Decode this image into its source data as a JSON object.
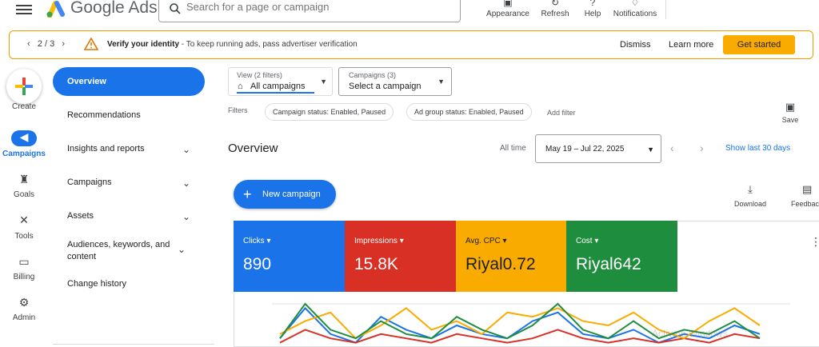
{
  "app": {
    "brand": "Google Ads"
  },
  "search": {
    "placeholder": "Search for a page or campaign"
  },
  "toolbar": {
    "items": [
      {
        "label": "Appearance",
        "icon": "appearance-icon"
      },
      {
        "label": "Refresh",
        "icon": "refresh-icon"
      },
      {
        "label": "Help",
        "icon": "help-icon"
      },
      {
        "label": "Notifications",
        "icon": "bell-icon"
      }
    ]
  },
  "banner": {
    "pager": "2 / 3",
    "title": "Verify your identity",
    "message": " - To keep running ads, pass advertiser verification",
    "dismiss": "Dismiss",
    "learn_more": "Learn more",
    "cta": "Get started",
    "accent": "#f9ab00"
  },
  "rail": {
    "create": "Create",
    "items": [
      {
        "label": "Campaigns",
        "icon": "megaphone-icon",
        "active": true
      },
      {
        "label": "Goals",
        "icon": "trophy-icon"
      },
      {
        "label": "Tools",
        "icon": "tools-icon"
      },
      {
        "label": "Billing",
        "icon": "billing-icon"
      },
      {
        "label": "Admin",
        "icon": "gear-icon"
      }
    ]
  },
  "sidenav": {
    "items": [
      {
        "label": "Overview",
        "active": true
      },
      {
        "label": "Recommendations"
      },
      {
        "label": "Insights and reports",
        "expandable": true
      },
      {
        "label": "Campaigns",
        "expandable": true
      },
      {
        "label": "Assets",
        "expandable": true
      },
      {
        "label": "Audiences, keywords, and content",
        "expandable": true
      },
      {
        "label": "Change history"
      }
    ]
  },
  "view_selector": {
    "caption": "View (2 filters)",
    "value": "All campaigns"
  },
  "campaign_selector": {
    "caption": "Campaigns (3)",
    "value": "Select a campaign"
  },
  "filters": {
    "label": "Filters",
    "chips": [
      "Campaign status: Enabled, Paused",
      "Ad group status: Enabled, Paused"
    ],
    "add": "Add filter",
    "save": "Save"
  },
  "overview": {
    "title": "Overview",
    "range_label": "All time",
    "date_range": "May 19 – Jul 22, 2025",
    "show_last": "Show last 30 days",
    "new_campaign": "New campaign",
    "download": "Download",
    "feedback": "Feedback"
  },
  "metrics": [
    {
      "name": "Clicks",
      "value": "890",
      "color": "#1a73e8"
    },
    {
      "name": "Impressions",
      "value": "15.8K",
      "color": "#d93025"
    },
    {
      "name": "Avg. CPC",
      "value": "Riyal0.72",
      "color": "#f9ab00"
    },
    {
      "name": "Cost",
      "value": "Riyal642",
      "color": "#1e8e3e"
    }
  ],
  "chart_data": {
    "type": "line",
    "series": [
      {
        "color": "#1a73e8",
        "values": [
          2,
          9,
          3,
          1,
          7,
          4,
          2,
          5,
          3,
          2,
          6,
          8,
          3,
          2,
          4,
          1,
          3,
          2,
          5,
          3
        ]
      },
      {
        "color": "#d93025",
        "values": [
          1,
          4,
          2,
          1,
          3,
          2,
          1,
          3,
          2,
          1,
          2,
          4,
          2,
          1,
          2,
          1,
          2,
          1,
          3,
          2
        ]
      },
      {
        "color": "#f9ab00",
        "values": [
          3,
          6,
          8,
          2,
          5,
          9,
          4,
          6,
          3,
          8,
          7,
          9,
          6,
          5,
          8,
          4,
          2,
          6,
          9,
          5
        ]
      },
      {
        "color": "#1e8e3e",
        "values": [
          2,
          10,
          4,
          2,
          6,
          3,
          2,
          7,
          4,
          2,
          5,
          10,
          4,
          2,
          6,
          2,
          4,
          3,
          6,
          2
        ]
      }
    ]
  },
  "watermark": "Activate Windows"
}
